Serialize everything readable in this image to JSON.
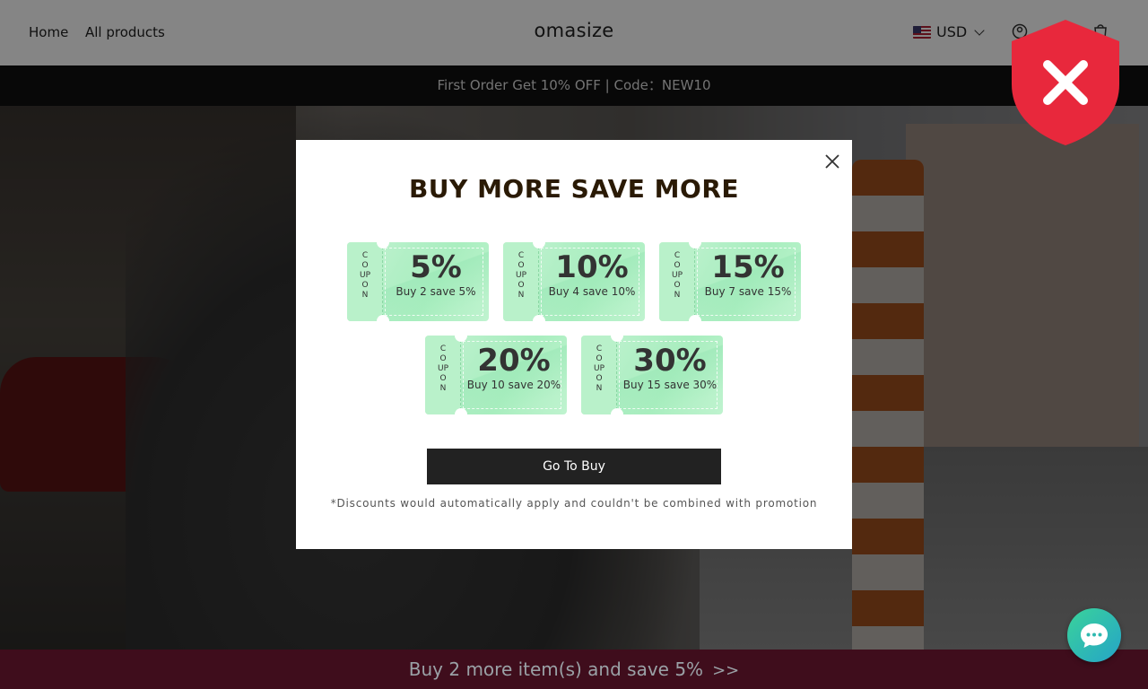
{
  "header": {
    "nav": [
      {
        "label": "Home"
      },
      {
        "label": "All products"
      }
    ],
    "brand": "omasize",
    "currency": "USD",
    "icons": [
      "account-icon",
      "cart-icon"
    ]
  },
  "announcement": "First Order Get 10% OFF | Code：NEW10",
  "popup": {
    "title": "BUY MORE SAVE MORE",
    "coupons": [
      {
        "percent": "5%",
        "desc": "Buy 2 save 5%"
      },
      {
        "percent": "10%",
        "desc": "Buy 4 save 10%"
      },
      {
        "percent": "15%",
        "desc": "Buy 7 save 15%"
      },
      {
        "percent": "20%",
        "desc": "Buy 10 save 20%"
      },
      {
        "percent": "30%",
        "desc": "Buy 15 save 30%"
      }
    ],
    "coupon_word": "COUPON",
    "button_label": "Go To Buy",
    "note": "*Discounts would automatically apply and couldn't be combined with promotion"
  },
  "bottom_bar": {
    "text": "Buy 2 more item(s) and save 5%",
    "arrows": ">>"
  },
  "colors": {
    "shield_red": "#e8283c",
    "chat_green": "#3ad39a",
    "coupon_green": "#b2efc6",
    "bottom_bar": "#3f0d1c"
  }
}
